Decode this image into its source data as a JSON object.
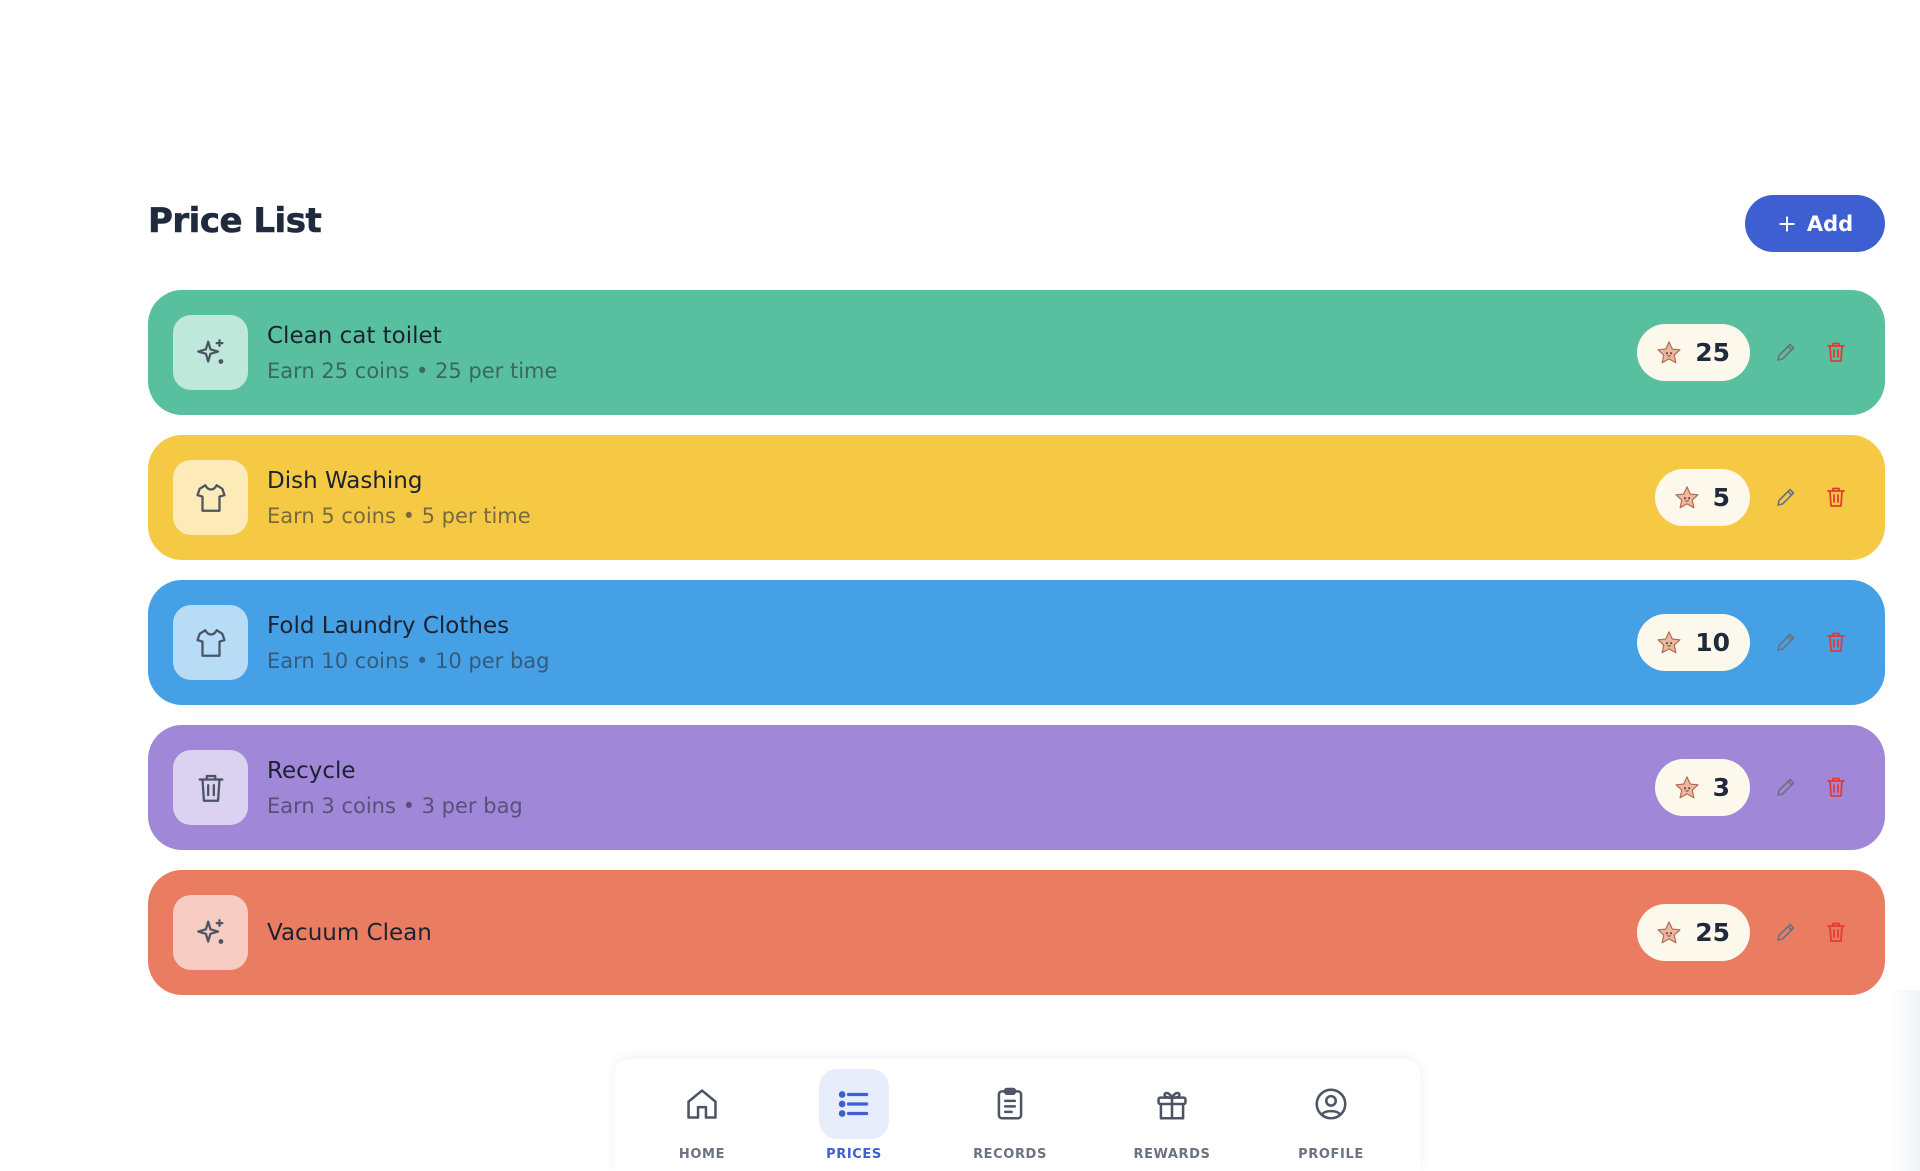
{
  "page": {
    "title": "Price List"
  },
  "header": {
    "add_label": "Add"
  },
  "items": [
    {
      "title": "Clean cat toilet",
      "subtitle": "Earn 25 coins • 25 per time",
      "coins": "25",
      "icon": "sparkles-icon",
      "color": "#58c09f"
    },
    {
      "title": "Dish Washing",
      "subtitle": "Earn 5 coins • 5 per time",
      "coins": "5",
      "icon": "shirt-icon",
      "color": "#f6c945"
    },
    {
      "title": "Fold Laundry Clothes",
      "subtitle": "Earn 10 coins • 10 per bag",
      "coins": "10",
      "icon": "shirt-icon",
      "color": "#46a0e6"
    },
    {
      "title": "Recycle",
      "subtitle": "Earn 3 coins • 3 per bag",
      "coins": "3",
      "icon": "trash-icon",
      "color": "#a087d8"
    },
    {
      "title": "Vacuum Clean",
      "subtitle": "",
      "coins": "25",
      "icon": "sparkles-icon",
      "color": "#ea7c62"
    }
  ],
  "nav": {
    "items": [
      {
        "label": "HOME",
        "icon": "home-icon",
        "active": false
      },
      {
        "label": "PRICES",
        "icon": "list-icon",
        "active": true
      },
      {
        "label": "RECORDS",
        "icon": "clipboard-icon",
        "active": false
      },
      {
        "label": "REWARDS",
        "icon": "gift-icon",
        "active": false
      },
      {
        "label": "PROFILE",
        "icon": "profile-icon",
        "active": false
      }
    ]
  },
  "colors": {
    "accent": "#3d5fd1",
    "delete": "#e53935",
    "coin_badge_bg": "#fdf8ec",
    "title_text": "#1f2a3d"
  }
}
